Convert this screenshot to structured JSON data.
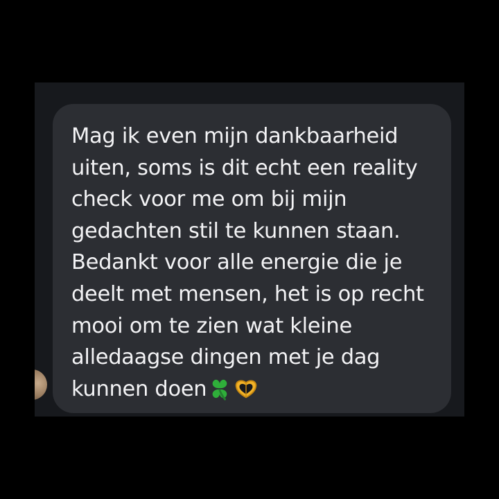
{
  "conversation": {
    "message": {
      "lines": [
        "Mag ik even mijn dankbaarheid",
        "uiten, soms is dit echt een reality",
        "check voor me om bij mijn",
        "gedachten stil te kunnen staan.",
        "Bedankt voor alle energie die je",
        "deelt met mensen, het is op recht",
        "mooi om te zien wat kleine",
        "alledaagse dingen met je dag",
        "kunnen doen"
      ],
      "emojis": [
        "four-leaf-clover",
        "heart-hands"
      ]
    }
  },
  "colors": {
    "background": "#000000",
    "chat_background": "#17191d",
    "bubble": "#2c2e33",
    "text": "#f3f3f5",
    "clover": "#2fae3a",
    "heart_hands": "#f2b329"
  }
}
